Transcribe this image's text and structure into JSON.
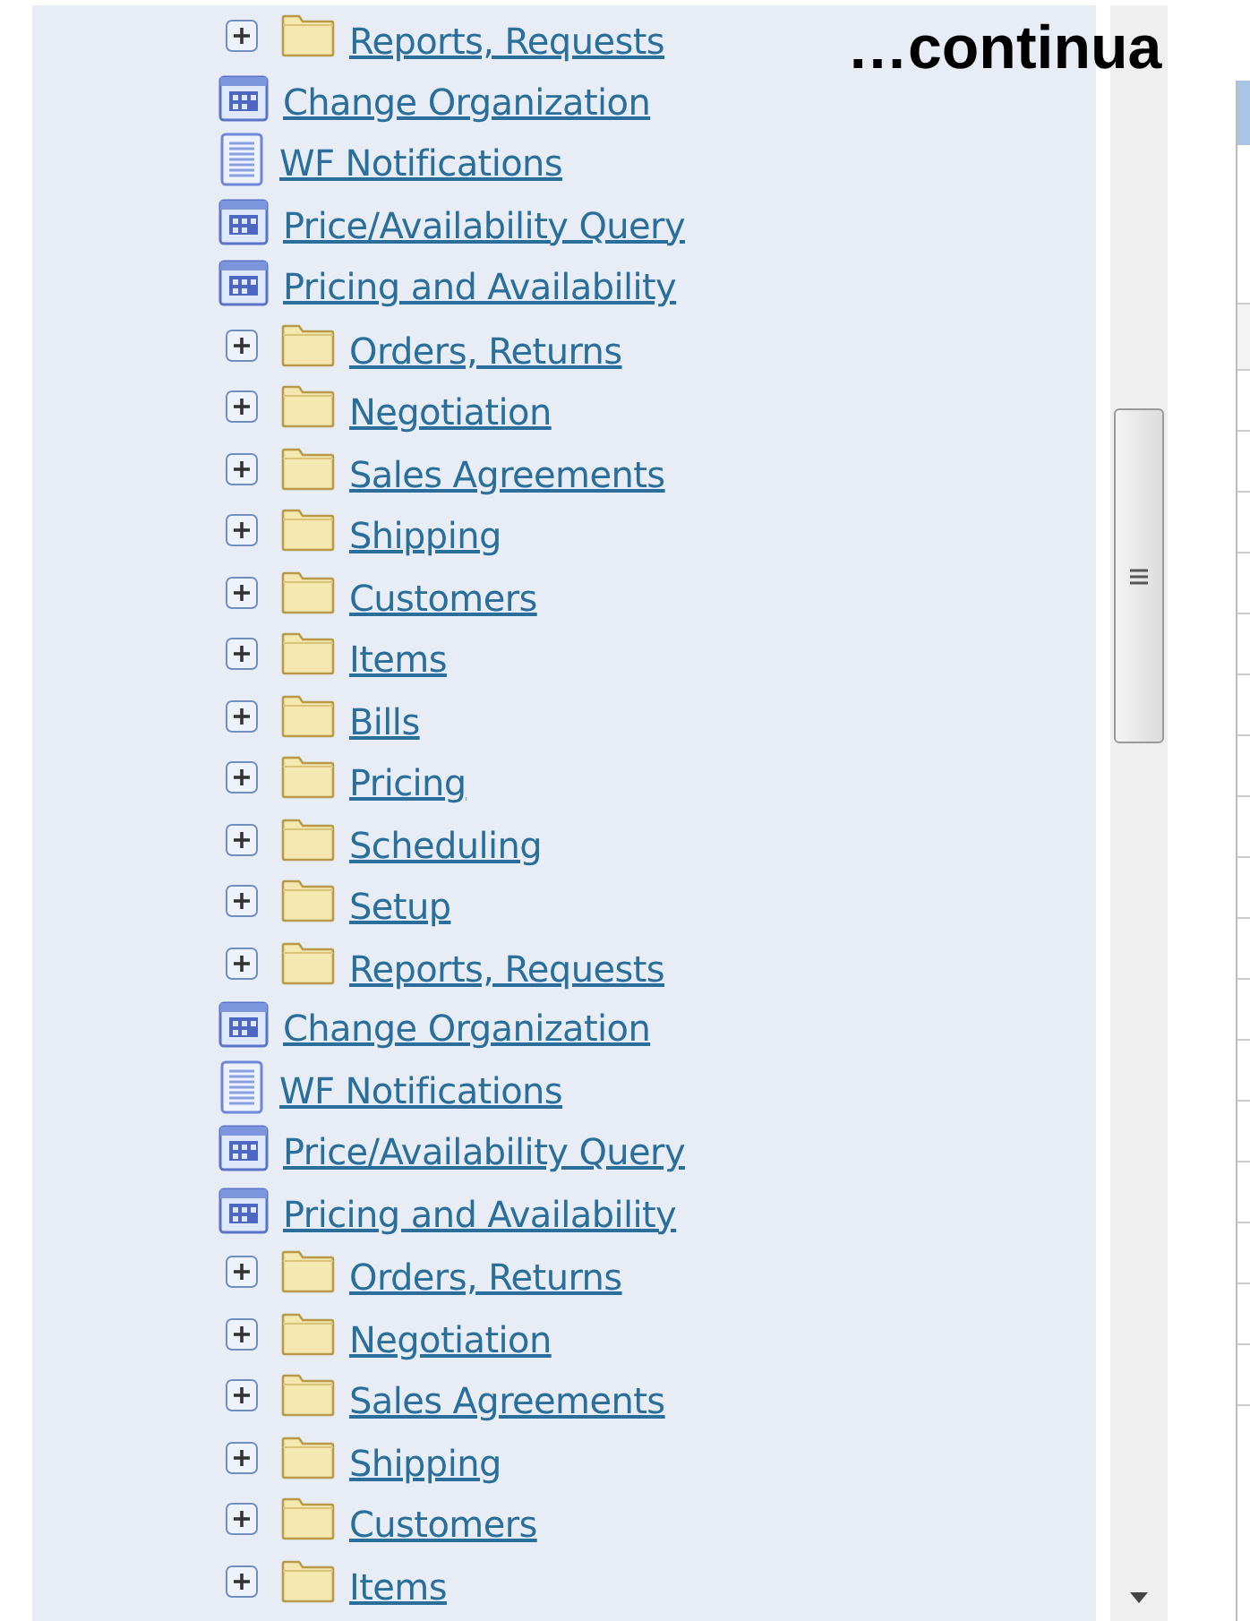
{
  "caption": "…continua",
  "tree": [
    {
      "kind": "folder",
      "label": "Reports, Requests",
      "expanded": false
    },
    {
      "kind": "form",
      "label": "Change Organization"
    },
    {
      "kind": "document",
      "label": "WF Notifications"
    },
    {
      "kind": "form",
      "label": "Price/Availability Query"
    },
    {
      "kind": "form",
      "label": "Pricing and Availability"
    },
    {
      "kind": "folder",
      "label": "Orders, Returns",
      "expanded": false
    },
    {
      "kind": "folder",
      "label": "Negotiation",
      "expanded": false
    },
    {
      "kind": "folder",
      "label": "Sales Agreements",
      "expanded": false
    },
    {
      "kind": "folder",
      "label": "Shipping",
      "expanded": false
    },
    {
      "kind": "folder",
      "label": "Customers",
      "expanded": false
    },
    {
      "kind": "folder",
      "label": "Items",
      "expanded": false
    },
    {
      "kind": "folder",
      "label": "Bills",
      "expanded": false
    },
    {
      "kind": "folder",
      "label": "Pricing",
      "expanded": false
    },
    {
      "kind": "folder",
      "label": "Scheduling",
      "expanded": false
    },
    {
      "kind": "folder",
      "label": "Setup",
      "expanded": false
    },
    {
      "kind": "folder",
      "label": "Reports, Requests",
      "expanded": false
    },
    {
      "kind": "form",
      "label": "Change Organization"
    },
    {
      "kind": "document",
      "label": "WF Notifications"
    },
    {
      "kind": "form",
      "label": "Price/Availability Query"
    },
    {
      "kind": "form",
      "label": "Pricing and Availability"
    },
    {
      "kind": "folder",
      "label": "Orders, Returns",
      "expanded": false
    },
    {
      "kind": "folder",
      "label": "Negotiation",
      "expanded": false
    },
    {
      "kind": "folder",
      "label": "Sales Agreements",
      "expanded": false
    },
    {
      "kind": "folder",
      "label": "Shipping",
      "expanded": false
    },
    {
      "kind": "folder",
      "label": "Customers",
      "expanded": false
    },
    {
      "kind": "folder",
      "label": "Items",
      "expanded": false
    }
  ]
}
